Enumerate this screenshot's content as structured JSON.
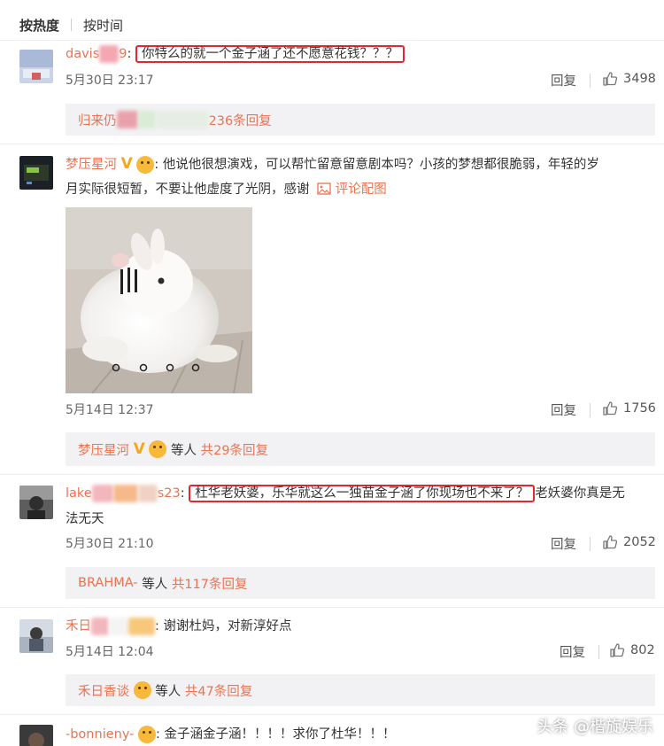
{
  "tabs": [
    {
      "label": "按热度"
    },
    {
      "label": "按时间"
    }
  ],
  "comments": [
    {
      "user_prefix": "davis",
      "user_suffix": "9",
      "text": "你特么的就一个金子涵了还不愿意花钱？？？",
      "date": "5月30日 23:17",
      "reply_label": "回复",
      "likes": "3498",
      "sub_user": "归来仍",
      "sub_count": "236条回复"
    },
    {
      "user": "梦压星河",
      "text_line1": "他说他很想演戏，可以帮忙留意留意剧本吗？小孩的梦想都很脆弱，年轻的岁",
      "text_line2": "月实际很短暂，不要让他虚度了光阴，感谢",
      "pic_link": "评论配图",
      "date": "5月14日 12:37",
      "reply_label": "回复",
      "likes": "1756",
      "sub_user": "梦压星河",
      "sub_mid": "等人",
      "sub_count": "共29条回复"
    },
    {
      "user_prefix": "lake",
      "user_suffix": "s23",
      "text_hl": "杜华老妖婆，乐华就这么一独苗金子涵了你现场也不来了？",
      "text_rest": "老妖婆你真是无",
      "text_line2": "法无天",
      "date": "5月30日 21:10",
      "reply_label": "回复",
      "likes": "2052",
      "sub_user": "BRAHMA-",
      "sub_mid": "等人",
      "sub_count": "共117条回复"
    },
    {
      "user_prefix": "禾日",
      "text": "谢谢杜妈，对新淳好点",
      "date": "5月14日 12:04",
      "reply_label": "回复",
      "likes": "802",
      "sub_user": "禾日香谈",
      "sub_mid": "等人",
      "sub_count": "共47条回复"
    },
    {
      "user": "-bonnieny-",
      "text": "金子涵金子涵！！！！求你了杜华！！！"
    }
  ],
  "watermark": "头条 @楷旋娱乐"
}
